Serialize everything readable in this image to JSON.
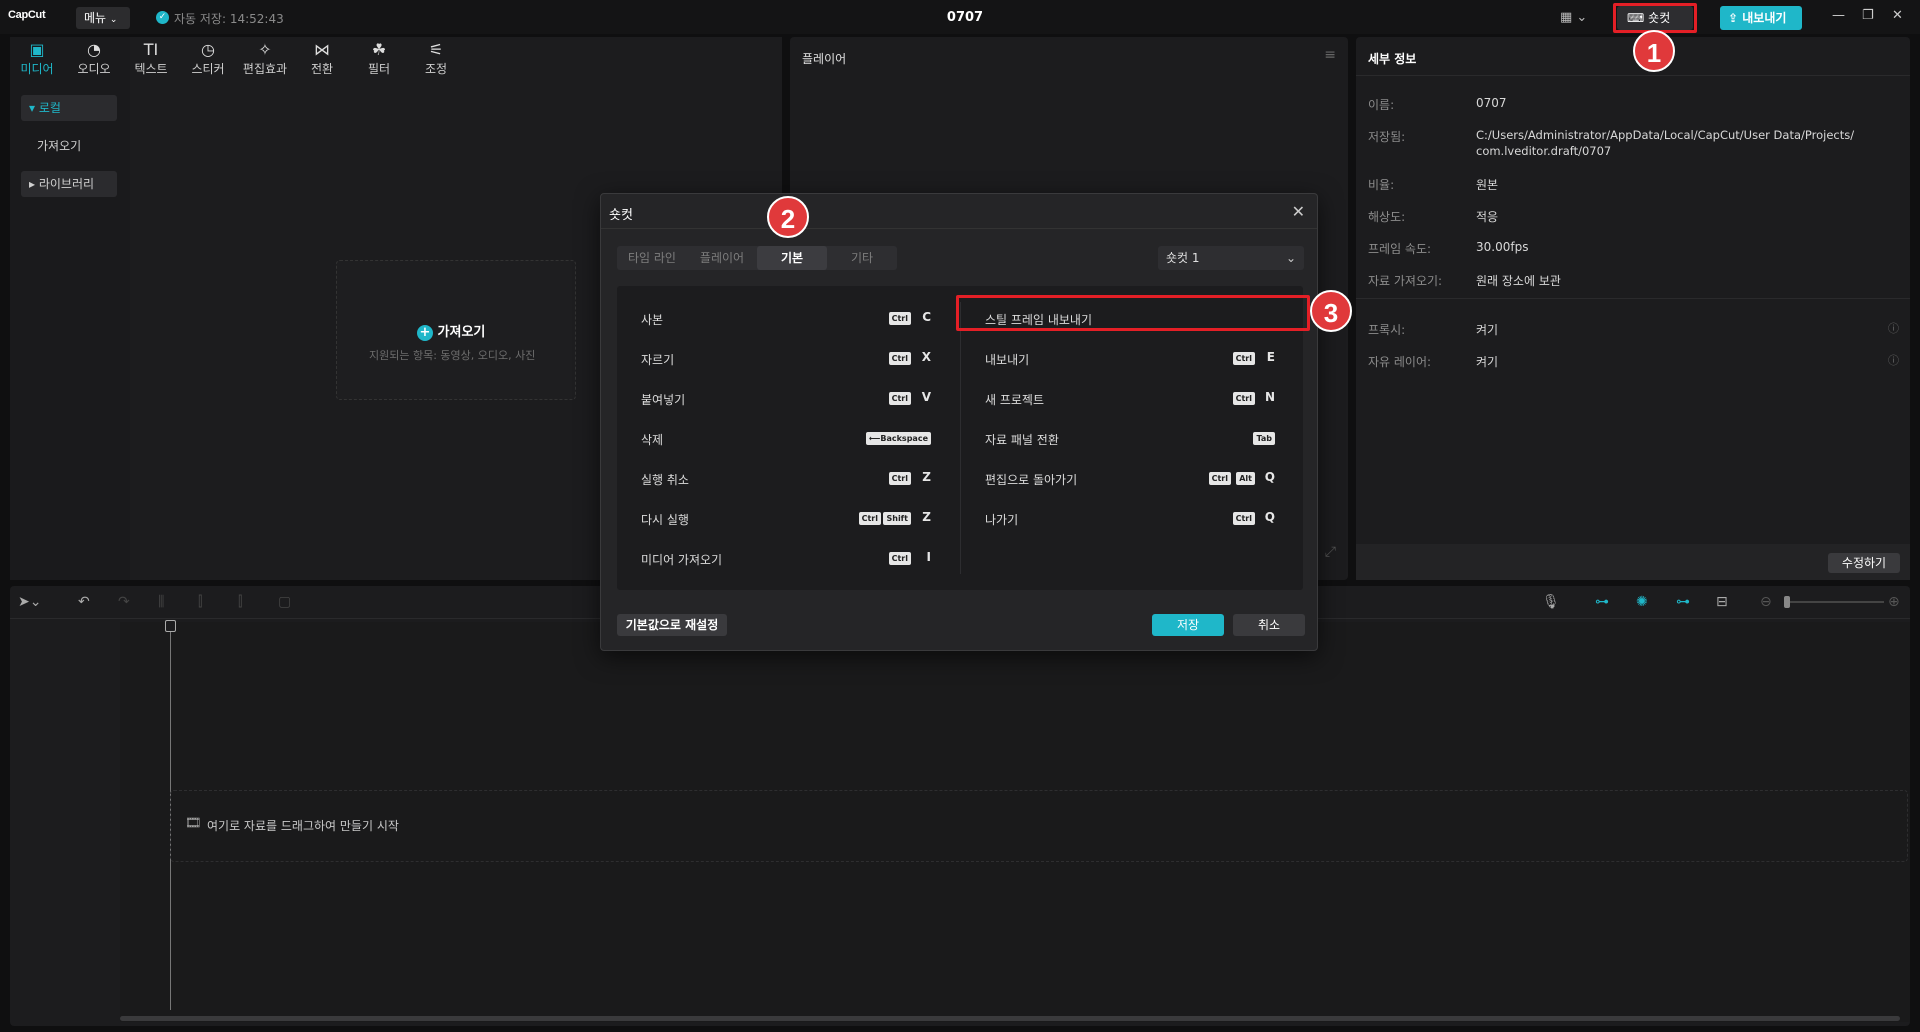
{
  "titlebar": {
    "logo": "CapCut",
    "menu": "메뉴",
    "autosave": "자동 저장: 14:52:43",
    "title": "0707",
    "shortcut": "숏컷",
    "export": "내보내기"
  },
  "tools": [
    {
      "label": "미디어",
      "icon": "media-icon"
    },
    {
      "label": "오디오",
      "icon": "audio-icon"
    },
    {
      "label": "텍스트",
      "icon": "text-icon"
    },
    {
      "label": "스티커",
      "icon": "sticker-icon"
    },
    {
      "label": "편집효과",
      "icon": "effects-icon"
    },
    {
      "label": "전환",
      "icon": "transition-icon"
    },
    {
      "label": "필터",
      "icon": "filter-icon"
    },
    {
      "label": "조정",
      "icon": "adjust-icon"
    }
  ],
  "sidebar": {
    "local": "▾ 로컬",
    "import": "가져오기",
    "library": "▸ 라이브러리"
  },
  "media": {
    "import": "가져오기",
    "supported": "지원되는 항목: 동영상, 오디오, 사진"
  },
  "player": {
    "title": "플레이어"
  },
  "details": {
    "title": "세부 정보",
    "rows": [
      {
        "label": "이름:",
        "value": "0707"
      },
      {
        "label": "저장됨:",
        "value": "C:/Users/Administrator/AppData/Local/CapCut/User Data/Projects/",
        "value2": "com.lveditor.draft/0707"
      },
      {
        "label": "비율:",
        "value": "원본"
      },
      {
        "label": "해상도:",
        "value": "적응"
      },
      {
        "label": "프레임 속도:",
        "value": "30.00fps"
      },
      {
        "label": "자료 가져오기:",
        "value": "원래 장소에 보관"
      },
      {
        "label": "프록시:",
        "value": "켜기"
      },
      {
        "label": "자유 레이어:",
        "value": "켜기"
      }
    ],
    "modify": "수정하기"
  },
  "timeline": {
    "drop_hint": "여기로 자료를 드래그하여 만들기 시작"
  },
  "dialog": {
    "title": "숏컷",
    "tabs": [
      "타임 라인",
      "플레이어",
      "기본",
      "기타"
    ],
    "preset": "숏컷 1",
    "left": [
      {
        "name": "사본",
        "keys": [
          "Ctrl"
        ],
        "letter": "C"
      },
      {
        "name": "자르기",
        "keys": [
          "Ctrl"
        ],
        "letter": "X"
      },
      {
        "name": "붙여넣기",
        "keys": [
          "Ctrl"
        ],
        "letter": "V"
      },
      {
        "name": "삭제",
        "keys": [
          "⟵Backspace"
        ],
        "letter": ""
      },
      {
        "name": "실행 취소",
        "keys": [
          "Ctrl"
        ],
        "letter": "Z"
      },
      {
        "name": "다시 실행",
        "keys": [
          "Ctrl",
          "Shift"
        ],
        "letter": "Z"
      },
      {
        "name": "미디어 가져오기",
        "keys": [
          "Ctrl"
        ],
        "letter": "I"
      }
    ],
    "right": [
      {
        "name": "스틸 프레임 내보내기",
        "keys": [],
        "letter": ""
      },
      {
        "name": "내보내기",
        "keys": [
          "Ctrl"
        ],
        "letter": "E"
      },
      {
        "name": "새 프로젝트",
        "keys": [
          "Ctrl"
        ],
        "letter": "N"
      },
      {
        "name": "자료 패널 전환",
        "keys": [
          "Tab"
        ],
        "letter": ""
      },
      {
        "name": "편집으로 돌아가기",
        "keys": [
          "Ctrl",
          "Alt"
        ],
        "letter": "Q"
      },
      {
        "name": "나가기",
        "keys": [
          "Ctrl"
        ],
        "letter": "Q"
      }
    ],
    "reset": "기본값으로 재설정",
    "save": "저장",
    "cancel": "취소"
  },
  "annotations": [
    "1",
    "2",
    "3"
  ],
  "colors": {
    "accent": "#1fb7c9",
    "annotation": "#e41f26"
  }
}
